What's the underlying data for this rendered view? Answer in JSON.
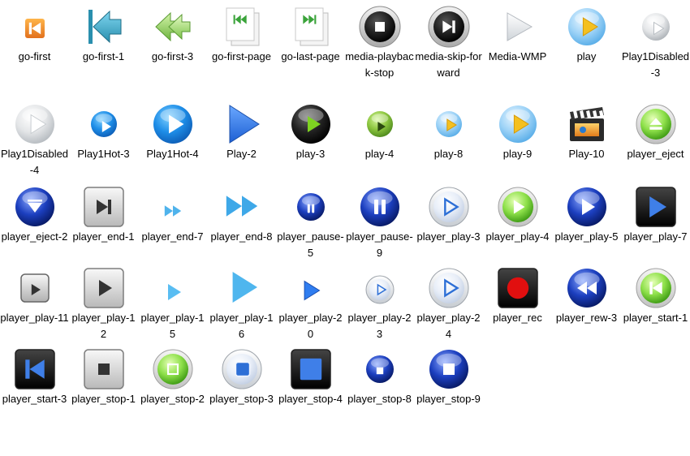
{
  "window": {
    "title": ""
  },
  "colors": {
    "background": "#ffffff",
    "label_text": "#000000"
  },
  "icons": [
    {
      "label": "go-first",
      "icon": "go-first-icon",
      "glyph": "back-bar",
      "style": "orange-small"
    },
    {
      "label": "go-first-1",
      "icon": "go-first-1-icon",
      "glyph": "back-bar",
      "style": "teal-arrow"
    },
    {
      "label": "go-first-3",
      "icon": "go-first-3-icon",
      "glyph": "rew",
      "style": "green-arrow"
    },
    {
      "label": "go-first-page",
      "icon": "go-first-page-icon",
      "glyph": "rew-bar",
      "style": "page"
    },
    {
      "label": "go-last-page",
      "icon": "go-last-page-icon",
      "glyph": "ff-bar",
      "style": "page"
    },
    {
      "label": "media-playback-stop",
      "icon": "media-playback-stop-icon",
      "glyph": "stop",
      "style": "gray-ring"
    },
    {
      "label": "media-skip-forward",
      "icon": "media-skip-forward-icon",
      "glyph": "skip",
      "style": "gray-ring"
    },
    {
      "label": "Media-WMP",
      "icon": "media-wmp-icon",
      "glyph": "play",
      "style": "white-triangle"
    },
    {
      "label": "play",
      "icon": "play-icon",
      "glyph": "play",
      "style": "lightblue-ball"
    },
    {
      "label": "Play1Disabled-3",
      "icon": "play1disabled-3-icon",
      "glyph": "play",
      "style": "gray-ball-small"
    },
    {
      "label": "Play1Disabled-4",
      "icon": "play1disabled-4-icon",
      "glyph": "play",
      "style": "gray-ball"
    },
    {
      "label": "Play1Hot-3",
      "icon": "play1hot-3-icon",
      "glyph": "play",
      "style": "blue-ball-small"
    },
    {
      "label": "Play1Hot-4",
      "icon": "play1hot-4-icon",
      "glyph": "play",
      "style": "blue-ball"
    },
    {
      "label": "Play-2",
      "icon": "play-2-icon",
      "glyph": "play",
      "style": "blue-triangle"
    },
    {
      "label": "play-3",
      "icon": "play-3-icon",
      "glyph": "play",
      "style": "black-ball"
    },
    {
      "label": "play-4",
      "icon": "play-4-icon",
      "glyph": "play",
      "style": "green-ball-small"
    },
    {
      "label": "play-8",
      "icon": "play-8-icon",
      "glyph": "play",
      "style": "lightblue-ball-small"
    },
    {
      "label": "play-9",
      "icon": "play-9-icon",
      "glyph": "play",
      "style": "lightblue-ball"
    },
    {
      "label": "Play-10",
      "icon": "play-10-icon",
      "glyph": "none",
      "style": "clapper"
    },
    {
      "label": "player_eject",
      "icon": "player-eject-icon",
      "glyph": "eject",
      "style": "green-ring"
    },
    {
      "label": "player_eject-2",
      "icon": "player-eject-2-icon",
      "glyph": "eject-down",
      "style": "darkblue-ball"
    },
    {
      "label": "player_end-1",
      "icon": "player-end-1-icon",
      "glyph": "skip",
      "style": "gray-square"
    },
    {
      "label": "player_end-7",
      "icon": "player-end-7-icon",
      "glyph": "ff",
      "style": "lightblue-small"
    },
    {
      "label": "player_end-8",
      "icon": "player-end-8-icon",
      "glyph": "ff",
      "style": "lightblue-large"
    },
    {
      "label": "player_pause-5",
      "icon": "player-pause-5-icon",
      "glyph": "pause",
      "style": "darkblue-ball-small"
    },
    {
      "label": "player_pause-9",
      "icon": "player-pause-9-icon",
      "glyph": "pause",
      "style": "darkblue-ball"
    },
    {
      "label": "player_play-3",
      "icon": "player-play-3-icon",
      "glyph": "play-outline",
      "style": "silver-ring"
    },
    {
      "label": "player_play-4",
      "icon": "player-play-4-icon",
      "glyph": "play",
      "style": "green-ring"
    },
    {
      "label": "player_play-5",
      "icon": "player-play-5-icon",
      "glyph": "play",
      "style": "darkblue-ball"
    },
    {
      "label": "player_play-7",
      "icon": "player-play-7-icon",
      "glyph": "play",
      "style": "black-square"
    },
    {
      "label": "player_play-11",
      "icon": "player-play-11-icon",
      "glyph": "play",
      "style": "gray-square-small"
    },
    {
      "label": "player_play-12",
      "icon": "player-play-12-icon",
      "glyph": "play",
      "style": "gray-square"
    },
    {
      "label": "player_play-15",
      "icon": "player-play-15-icon",
      "glyph": "play",
      "style": "lightblue-tri-small"
    },
    {
      "label": "player_play-16",
      "icon": "player-play-16-icon",
      "glyph": "play",
      "style": "lightblue-tri-large"
    },
    {
      "label": "player_play-20",
      "icon": "player-play-20-icon",
      "glyph": "play",
      "style": "blue-tri-medium"
    },
    {
      "label": "player_play-23",
      "icon": "player-play-23-icon",
      "glyph": "play-outline",
      "style": "silver-ring-small"
    },
    {
      "label": "player_play-24",
      "icon": "player-play-24-icon",
      "glyph": "play-outline",
      "style": "silver-ring"
    },
    {
      "label": "player_rec",
      "icon": "player-rec-icon",
      "glyph": "rec",
      "style": "black-square"
    },
    {
      "label": "player_rew-3",
      "icon": "player-rew-3-icon",
      "glyph": "rew",
      "style": "darkblue-ball"
    },
    {
      "label": "player_start-1",
      "icon": "player-start-1-icon",
      "glyph": "back-bar",
      "style": "green-ring"
    },
    {
      "label": "player_start-3",
      "icon": "player-start-3-icon",
      "glyph": "back-bar",
      "style": "black-square"
    },
    {
      "label": "player_stop-1",
      "icon": "player-stop-1-icon",
      "glyph": "stop",
      "style": "gray-square"
    },
    {
      "label": "player_stop-2",
      "icon": "player-stop-2-icon",
      "glyph": "stop-outline",
      "style": "green-ring"
    },
    {
      "label": "player_stop-3",
      "icon": "player-stop-3-icon",
      "glyph": "stop-rounded",
      "style": "silver-ring"
    },
    {
      "label": "player_stop-4",
      "icon": "player-stop-4-icon",
      "glyph": "stop-big",
      "style": "black-square"
    },
    {
      "label": "player_stop-8",
      "icon": "player-stop-8-icon",
      "glyph": "stop",
      "style": "darkblue-ball-small"
    },
    {
      "label": "player_stop-9",
      "icon": "player-stop-9-icon",
      "glyph": "stop",
      "style": "darkblue-ball"
    }
  ]
}
